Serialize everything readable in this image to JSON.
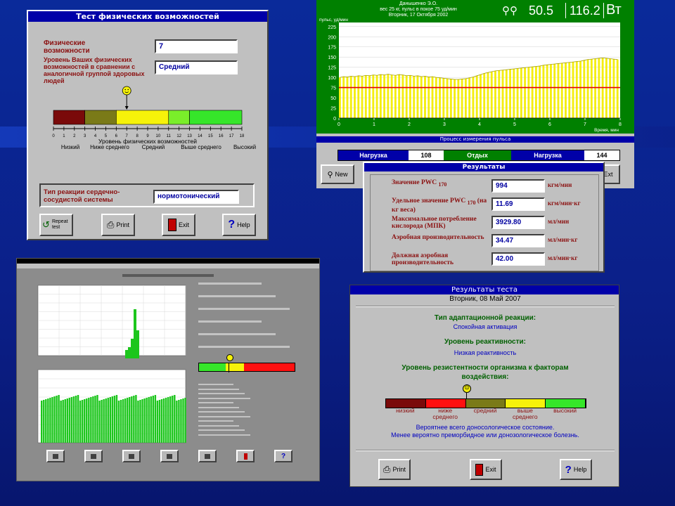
{
  "w1": {
    "title": "Тест физических возможностей",
    "phys_label": "Физические возможности",
    "phys_value": "7",
    "level_label": "Уровень Ваших физических возможностей в сравнении с аналогичной группой здоровых людей",
    "level_value": "Средний",
    "scale_ticks": [
      "0",
      "1",
      "2",
      "3",
      "4",
      "5",
      "6",
      "7",
      "8",
      "9",
      "10",
      "11",
      "12",
      "13",
      "14",
      "15",
      "16",
      "17",
      "18"
    ],
    "scale_caption": "Уровень физических возможностей",
    "scale_segment_colors": [
      "#7a0a0a",
      "#7a7a18",
      "#f6f20a",
      "#7aee2a",
      "#36e62a"
    ],
    "scale_marker_value": 7,
    "categories": [
      "Низкий",
      "Ниже среднего",
      "Средний",
      "Выше среднего",
      "Высокий"
    ],
    "reaction_label": "Тип реакции сердечно-сосудистой системы",
    "reaction_value": "нормотонический",
    "buttons": [
      "Repeat test",
      "Print",
      "Exit",
      "Help"
    ]
  },
  "w2": {
    "header_lines": [
      "Данышенко Э.О.",
      "вес 25 кг, пульс в покое 75 уд/мин",
      "Вторник, 17 Октября 2002"
    ],
    "readout_1": "50.5",
    "readout_2": "116.2",
    "readout_unit": "Вт",
    "ylabel": "пульс, уд/мин",
    "xlabel": "Время, мин",
    "yticks": [
      "0",
      "25",
      "50",
      "75",
      "100",
      "125",
      "150",
      "175",
      "200",
      "225"
    ],
    "xticks": [
      "0",
      "1",
      "2",
      "3",
      "4",
      "5",
      "6",
      "7",
      "8"
    ],
    "process_label": "Процесс измерения пульса",
    "status": [
      "Нагрузка",
      "108",
      "Отдых",
      "Нагрузка",
      "144"
    ],
    "left_button": "New",
    "right_button": "Ext"
  },
  "chart_data": [
    {
      "type": "bar",
      "ylabel": "пульс, уд/мин",
      "xlabel": "Время, мин",
      "xlim": [
        0,
        8
      ],
      "ylim": [
        0,
        235
      ],
      "threshold": 75,
      "values": [
        100,
        102,
        101,
        103,
        102,
        104,
        103,
        105,
        104,
        106,
        105,
        107,
        106,
        108,
        106,
        105,
        107,
        106,
        104,
        105,
        103,
        104,
        102,
        103,
        101,
        102,
        100,
        99,
        98,
        97,
        96,
        95,
        95,
        96,
        97,
        99,
        101,
        104,
        107,
        110,
        112,
        114,
        116,
        117,
        118,
        119,
        120,
        121,
        122,
        123,
        124,
        125,
        126,
        127,
        128,
        130,
        131,
        132,
        133,
        134,
        135,
        136,
        137,
        138,
        139,
        140,
        142,
        144,
        145,
        146,
        147,
        148,
        147,
        146,
        145,
        144
      ]
    }
  ],
  "w3": {
    "title": "Результаты",
    "rows": [
      {
        "label": "Значение PWC",
        "sub": "170",
        "value": "994",
        "unit": "кгм/мин"
      },
      {
        "label": "Удельное значение PWC",
        "sub": "170",
        "label_suffix": "(на кг веса)",
        "value": "11.69",
        "unit": "кгм/мин·кг"
      },
      {
        "label": "Максимальное потребление кислорода (МПК)",
        "value": "3929.80",
        "unit": "мл/мин"
      },
      {
        "label": "Аэробная производительность",
        "value": "34.47",
        "unit": "мл/мин·кг"
      },
      {
        "label": "Должная аэробная производительность",
        "value": "42.00",
        "unit": "мл/мин·кг"
      }
    ]
  },
  "w5": {
    "title": "Результаты теста",
    "date": "Вторник, 08 Май 2007",
    "h1": "Тип адаптационной реакции:",
    "v1": "Спокойная активация",
    "h2": "Уровень реактивности:",
    "v2": "Низкая реактивность",
    "h3": "Уровень резистентности организма к факторам воздействия:",
    "scale_colors": [
      "#7a0a0a",
      "#ff1010",
      "#7a7a18",
      "#f6f20a",
      "#36e62a"
    ],
    "scale_labels": [
      "низкий",
      "ниже среднего",
      "средний",
      "выше среднего",
      "высокий"
    ],
    "conclusion_1": "Вероятнее всего доносологическое состояние.",
    "conclusion_2": "Менее вероятно преморбидное или донозологическое болезнь.",
    "buttons": [
      "Print",
      "Exit",
      "Help"
    ]
  }
}
